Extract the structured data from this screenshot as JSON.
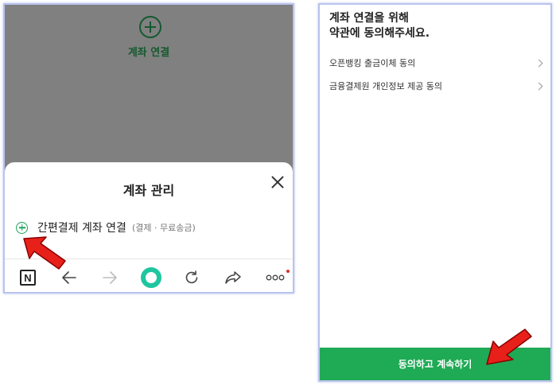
{
  "left_panel": {
    "background_connect_label": "계좌 연결",
    "sheet": {
      "title": "계좌 관리",
      "row_label": "간편결제 계좌 연결",
      "row_sublabel": "(결제 · 무료송금)"
    },
    "toolbar": {
      "items": [
        "naver-home-icon",
        "back-arrow-icon",
        "forward-arrow-icon",
        "green-circle-icon",
        "refresh-icon",
        "share-icon",
        "more-icon"
      ],
      "n_label": "N",
      "more_label": "ooo"
    }
  },
  "right_panel": {
    "heading_line1": "계좌 연결을 위해",
    "heading_line2": "약관에 동의해주세요.",
    "agreements": [
      "오픈뱅킹 출금이체 동의",
      "금융결제원 개인정보 제공 동의"
    ],
    "continue_button": "동의하고 계속하기"
  },
  "colors": {
    "accent_green": "#1faa55",
    "dim_overlay": "#808080",
    "arrow_red": "#e8201a"
  }
}
